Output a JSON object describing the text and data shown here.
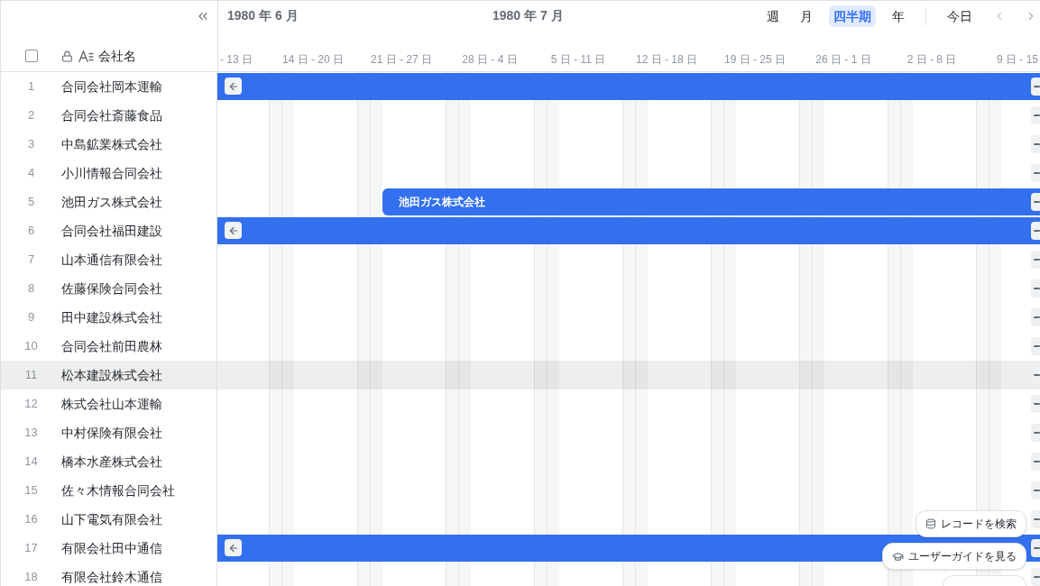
{
  "select_all": {
    "checked": false
  },
  "column_header": {
    "label": "会社名",
    "locked": true
  },
  "timeline": {
    "months": [
      "1980 年 6 月",
      "1980 年 7 月"
    ],
    "weeks": [
      "- 13 日",
      "14 日 - 20 日",
      "21 日 - 27 日",
      "28 日 - 4 日",
      "5 日 - 11 日",
      "12 日 - 18 日",
      "19 日 - 25 日",
      "26 日 - 1 日",
      "2 日 - 8 日",
      "9 日 - 15"
    ]
  },
  "toolbar": {
    "views": [
      {
        "label": "週",
        "selected": false
      },
      {
        "label": "月",
        "selected": false
      },
      {
        "label": "四半期",
        "selected": true
      },
      {
        "label": "年",
        "selected": false
      }
    ],
    "today": "今日"
  },
  "rows": [
    {
      "number": "1",
      "name": "合同会社岡本運輸",
      "highlighted": false,
      "bar": {
        "starts_before_view": true
      }
    },
    {
      "number": "2",
      "name": "合同会社斎藤食品",
      "highlighted": false
    },
    {
      "number": "3",
      "name": "中島鉱業株式会社",
      "highlighted": false
    },
    {
      "number": "4",
      "name": "小川情報合同会社",
      "highlighted": false
    },
    {
      "number": "5",
      "name": "池田ガス株式会社",
      "highlighted": false,
      "bar": {
        "starts_before_view": false,
        "label": "池田ガス株式会社"
      }
    },
    {
      "number": "6",
      "name": "合同会社福田建設",
      "highlighted": false,
      "bar": {
        "starts_before_view": true
      }
    },
    {
      "number": "7",
      "name": "山本通信有限会社",
      "highlighted": false
    },
    {
      "number": "8",
      "name": "佐藤保険合同会社",
      "highlighted": false
    },
    {
      "number": "9",
      "name": "田中建設株式会社",
      "highlighted": false
    },
    {
      "number": "10",
      "name": "合同会社前田農林",
      "highlighted": false
    },
    {
      "number": "11",
      "name": "松本建設株式会社",
      "highlighted": true
    },
    {
      "number": "12",
      "name": "株式会社山本運輸",
      "highlighted": false
    },
    {
      "number": "13",
      "name": "中村保険有限会社",
      "highlighted": false
    },
    {
      "number": "14",
      "name": "橋本水産株式会社",
      "highlighted": false
    },
    {
      "number": "15",
      "name": "佐々木情報合同会社",
      "highlighted": false
    },
    {
      "number": "16",
      "name": "山下電気有限会社",
      "highlighted": false
    },
    {
      "number": "17",
      "name": "有限会社田中通信",
      "highlighted": false,
      "bar": {
        "starts_before_view": true
      }
    },
    {
      "number": "18",
      "name": "有限会社鈴木通信",
      "highlighted": false
    }
  ],
  "help_menu": [
    {
      "kind": "records",
      "label": "レコードを検索"
    },
    {
      "kind": "guide",
      "label": "ユーザーガイドを見る"
    }
  ]
}
